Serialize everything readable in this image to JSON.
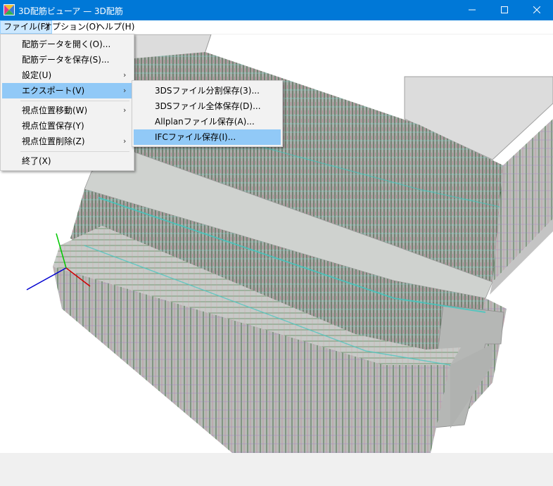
{
  "window": {
    "title": "3D配筋ビューア — 3D配筋",
    "controls": [
      "minimize",
      "maximize",
      "close"
    ]
  },
  "menubar": {
    "items": [
      {
        "label": "ファイル(F)",
        "active": true
      },
      {
        "label": "オプション(O)",
        "active": false
      },
      {
        "label": "ヘルプ(H)",
        "active": false
      }
    ]
  },
  "file_menu": {
    "items": [
      {
        "label": "配筋データを開く(O)...",
        "submenu": false
      },
      {
        "label": "配筋データを保存(S)...",
        "submenu": false
      },
      {
        "label": "設定(U)",
        "submenu": true
      },
      {
        "label": "エクスポート(V)",
        "submenu": true,
        "highlighted": true
      },
      {
        "label": "視点位置移動(W)",
        "submenu": true
      },
      {
        "label": "視点位置保存(Y)",
        "submenu": false
      },
      {
        "label": "視点位置削除(Z)",
        "submenu": true
      },
      {
        "label": "終了(X)",
        "submenu": false
      }
    ]
  },
  "export_submenu": {
    "items": [
      {
        "label": "3DSファイル分割保存(3)...",
        "highlighted": false
      },
      {
        "label": "3DSファイル全体保存(D)...",
        "highlighted": false
      },
      {
        "label": "Allplanファイル保存(A)...",
        "highlighted": false
      },
      {
        "label": "IFCファイル保存(I)...",
        "highlighted": true
      }
    ]
  },
  "colors": {
    "titlebar": "#0078d7",
    "menu_highlight": "#91c9f7",
    "rebar_green": "#3a8a2e",
    "rebar_cyan": "#40c8c0",
    "rebar_red": "#d04040",
    "rebar_purple": "#8a5ac8",
    "concrete": "#bdbdbd"
  }
}
